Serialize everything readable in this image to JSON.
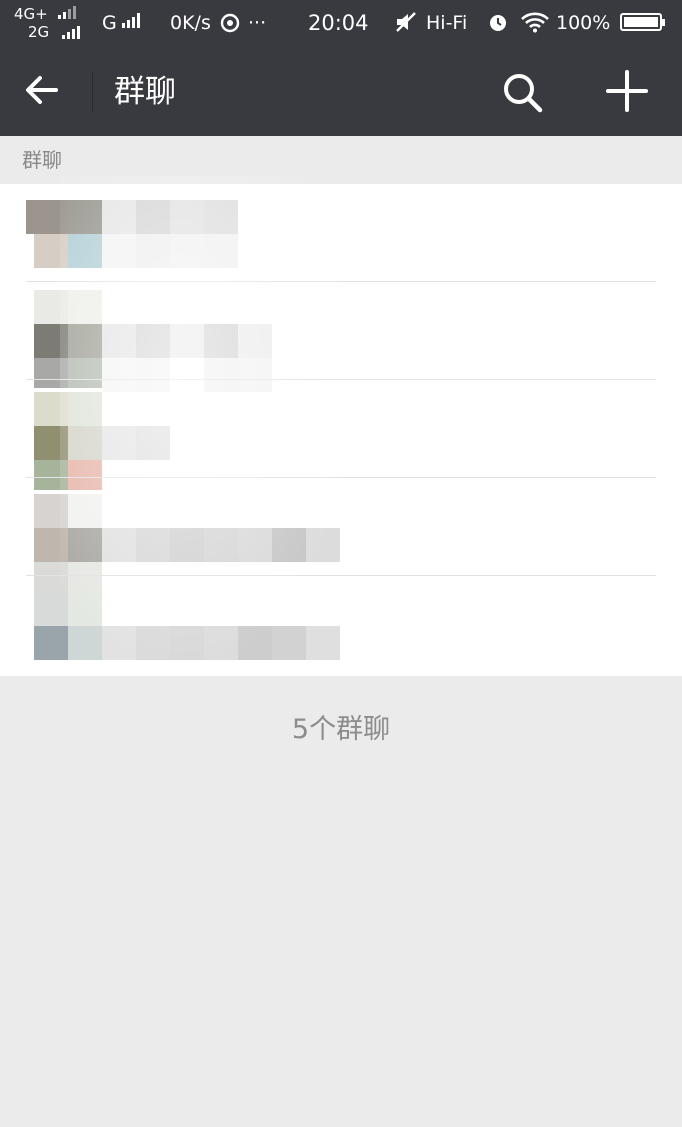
{
  "status_bar": {
    "network_top": "4G+",
    "network_bottom": "2G",
    "network_g": "G",
    "speed": "0K/s",
    "more": "···",
    "time": "20:04",
    "audio": "Hi-Fi",
    "battery": "100%"
  },
  "header": {
    "title": "群聊",
    "back_icon": "arrow-left-icon",
    "search_icon": "search-icon",
    "add_icon": "plus-icon",
    "background": "#393a3f"
  },
  "section": {
    "label": "群聊"
  },
  "group_list": {
    "items": [
      {
        "name": "",
        "obscured": true
      },
      {
        "name": "",
        "obscured": true
      },
      {
        "name": "",
        "obscured": true
      },
      {
        "name": "",
        "obscured": true
      },
      {
        "name": "",
        "obscured": true
      }
    ]
  },
  "footer": {
    "count_text": "5个群聊"
  }
}
